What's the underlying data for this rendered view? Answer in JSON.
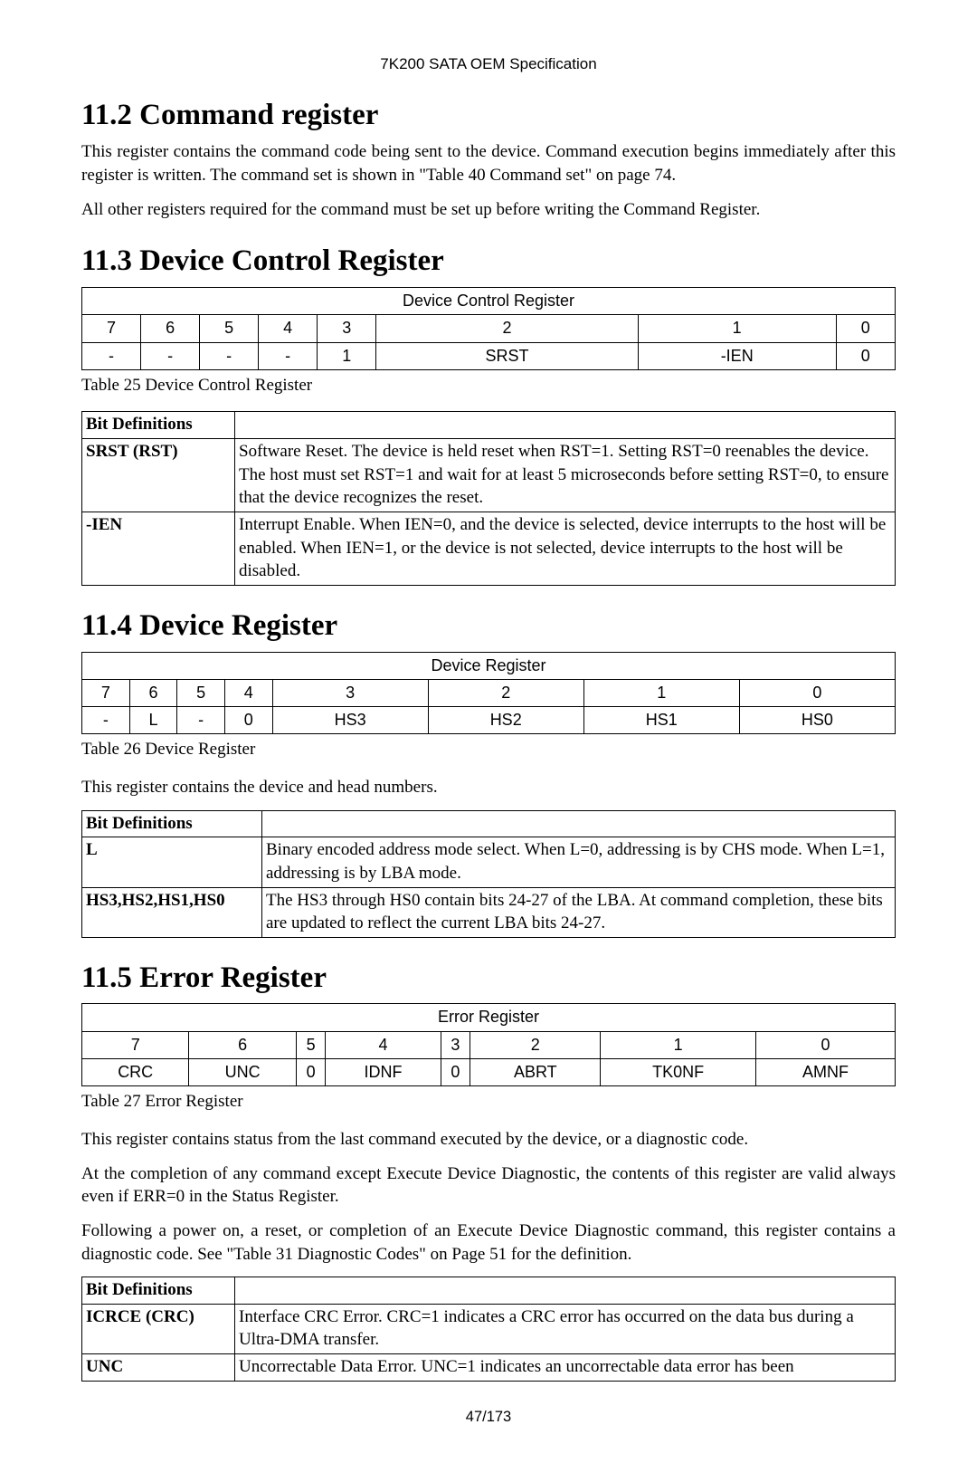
{
  "header": "7K200 SATA OEM Specification",
  "page_number": "47/173",
  "s112": {
    "heading": "11.2  Command register",
    "p1": "This register contains the command code being sent to the device. Command execution begins immediately after this register is written. The command set is shown in  \"Table 40 Command set\" on page 74.",
    "p2": "All other registers required for the command must be set up before writing the Command Register."
  },
  "s113": {
    "heading": "11.3  Device Control Register",
    "table_title": "Device Control Register",
    "bits": [
      "7",
      "6",
      "5",
      "4",
      "3",
      "2",
      "1",
      "0"
    ],
    "vals": [
      "-",
      "-",
      "-",
      "-",
      "1",
      "SRST",
      "-IEN",
      "0"
    ],
    "caption": "Table 25 Device Control Register",
    "bitdef_header": "Bit Definitions",
    "rows": [
      {
        "label": "SRST (RST)",
        "desc": "Software Reset. The device is held reset when RST=1. Setting RST=0 reenables the device. The host must set RST=1 and wait for at least 5 microseconds before setting RST=0, to ensure that the device recognizes the reset."
      },
      {
        "label": "-IEN",
        "desc": "Interrupt Enable. When IEN=0, and the device is selected, device interrupts to the host will be enabled. When IEN=1, or the device is not selected, device interrupts to the host will be disabled."
      }
    ]
  },
  "s114": {
    "heading": "11.4  Device Register",
    "table_title": "Device Register",
    "bits": [
      "7",
      "6",
      "5",
      "4",
      "3",
      "2",
      "1",
      "0"
    ],
    "vals": [
      "-",
      "L",
      "-",
      "0",
      "HS3",
      "HS2",
      "HS1",
      "HS0"
    ],
    "caption": "Table 26 Device Register",
    "intro": "This register contains the device and head numbers.",
    "bitdef_header": "Bit Definitions",
    "rows": [
      {
        "label": "L",
        "desc": "Binary encoded address mode select. When L=0, addressing is by CHS mode. When L=1, addressing is by LBA mode."
      },
      {
        "label": "HS3,HS2,HS1,HS0",
        "desc": "The HS3 through HS0 contain bits 24-27 of the LBA. At command completion, these bits are updated to reflect the current LBA bits 24-27."
      }
    ]
  },
  "s115": {
    "heading": "11.5  Error Register",
    "table_title": "Error Register",
    "bits": [
      "7",
      "6",
      "5",
      "4",
      "3",
      "2",
      "1",
      "0"
    ],
    "vals": [
      "CRC",
      "UNC",
      "0",
      "IDNF",
      "0",
      "ABRT",
      "TK0NF",
      "AMNF"
    ],
    "caption": "Table 27 Error Register",
    "p1": "This register contains status from the last command executed by the device, or a diagnostic code.",
    "p2": "At the completion of any command except Execute Device Diagnostic, the contents of this register are valid always even if ERR=0 in the Status Register.",
    "p3": "Following a power on, a reset, or completion of an Execute Device Diagnostic command, this register contains a diagnostic code. See \"Table 31 Diagnostic Codes\" on Page 51 for the definition.",
    "bitdef_header": "Bit Definitions",
    "rows": [
      {
        "label": "ICRCE (CRC)",
        "desc": "Interface CRC Error. CRC=1 indicates a CRC error has occurred on the data bus during a Ultra-DMA transfer."
      },
      {
        "label": "UNC",
        "desc": "Uncorrectable Data Error. UNC=1 indicates an uncorrectable data error has been"
      }
    ]
  }
}
